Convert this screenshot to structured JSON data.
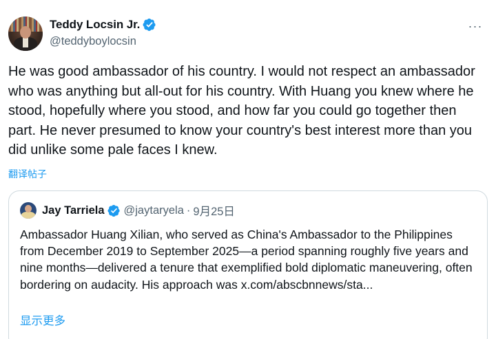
{
  "author": {
    "display_name": "Teddy Locsin Jr.",
    "handle": "@teddyboylocsin",
    "verified": true,
    "verified_color": "#1d9bf0"
  },
  "more_icon": "more-horizontal-icon",
  "more_glyph": "···",
  "tweet_text": "He was good ambassador of his country. I would not respect an ambassador who was anything but all-out for his country. With Huang you knew where he stood, hopefully where you stood, and how far you could go together then part. He never presumed to know your country's best interest more than you did unlike some pale faces I knew.",
  "translate_label": "翻译帖子",
  "quoted_tweet": {
    "display_name": "Jay Tarriela",
    "handle": "@jaytaryela",
    "separator": "·",
    "date": "9月25日",
    "verified": true,
    "text": "Ambassador Huang Xilian, who served as China's Ambassador to the Philippines from December 2019 to September 2025—a period spanning roughly five years and nine months—delivered a tenure that exemplified bold diplomatic maneuvering, often bordering on audacity. His approach was x.com/abscbnnews/sta...",
    "show_more_label": "显示更多"
  },
  "colors": {
    "text": "#0f1419",
    "secondary": "#536471",
    "link": "#1d9bf0",
    "border": "#cfd9de"
  }
}
